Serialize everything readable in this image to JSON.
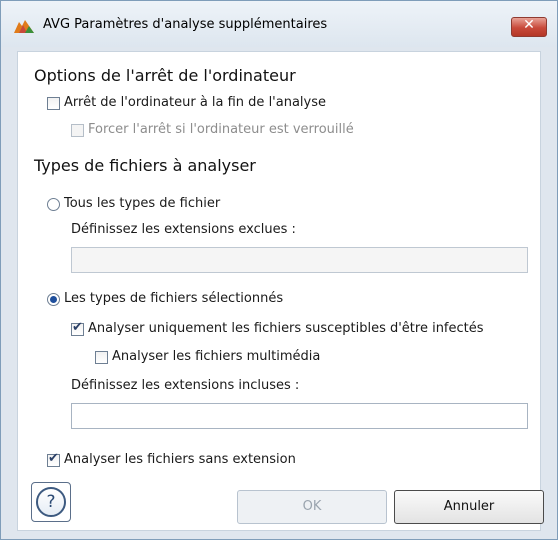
{
  "window": {
    "title": "AVG Paramètres d'analyse supplémentaires",
    "close_label": "✕"
  },
  "shutdown": {
    "title": "Options de l'arrêt de l'ordinateur",
    "shutdown_after_scan": {
      "label": "Arrêt de l'ordinateur à la fin de l'analyse",
      "checked": false
    },
    "force_shutdown": {
      "label": "Forcer l'arrêt si l'ordinateur est verrouillé",
      "checked": false,
      "enabled": false
    }
  },
  "file_types": {
    "title": "Types de fichiers à analyser",
    "all_types": {
      "label": "Tous les types de fichier",
      "selected": false
    },
    "excluded_label": "Définissez les extensions exclues :",
    "excluded_value": "",
    "selected_types": {
      "label": "Les types de fichiers sélectionnés",
      "selected": true
    },
    "only_infectable": {
      "label": "Analyser uniquement les fichiers susceptibles d'être infectés",
      "checked": true
    },
    "multimedia": {
      "label": "Analyser les fichiers multimédia",
      "checked": false
    },
    "included_label": "Définissez les extensions incluses :",
    "included_value": "",
    "no_extension": {
      "label": "Analyser les fichiers sans extension",
      "checked": true
    }
  },
  "footer": {
    "help_label": "?",
    "ok_label": "OK",
    "cancel_label": "Annuler"
  },
  "colors": {
    "accent_red": "#c8493a",
    "accent_green": "#3a8f3a",
    "accent_orange": "#e07b1a"
  }
}
